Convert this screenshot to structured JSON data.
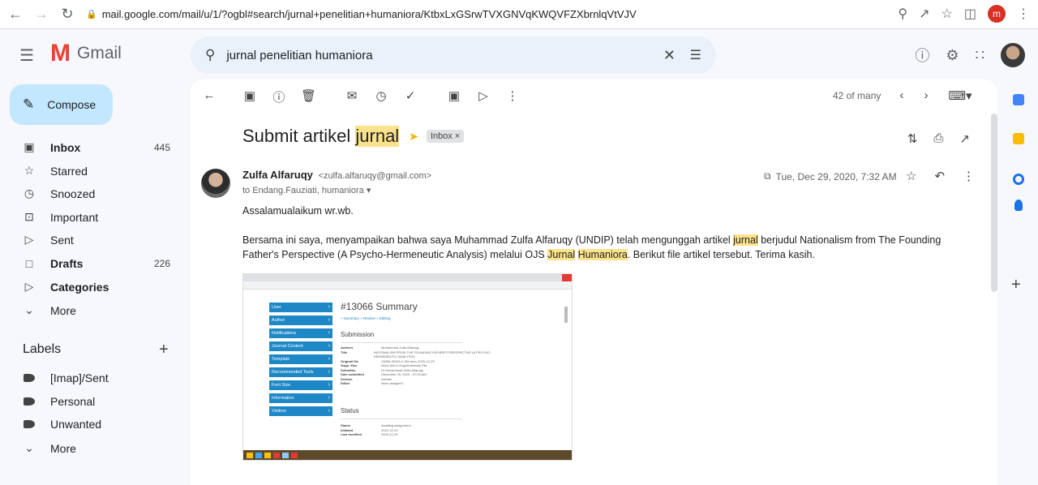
{
  "browser": {
    "url": "mail.google.com/mail/u/1/?ogbl#search/jurnal+penelitian+humaniora/KtbxLxGSrwTVXGNVqKWQVFZXbrnlqVtVJV",
    "profile_letter": "m"
  },
  "app": {
    "name": "Gmail"
  },
  "search": {
    "query": "jurnal penelitian humaniora"
  },
  "sidebar": {
    "compose": "Compose",
    "items": [
      {
        "label": "Inbox",
        "count": "445",
        "icon": "inbox-icon",
        "bold": true
      },
      {
        "label": "Starred",
        "count": "",
        "icon": "star-icon"
      },
      {
        "label": "Snoozed",
        "count": "",
        "icon": "clock-icon"
      },
      {
        "label": "Important",
        "count": "",
        "icon": "important-icon"
      },
      {
        "label": "Sent",
        "count": "",
        "icon": "send-icon"
      },
      {
        "label": "Drafts",
        "count": "226",
        "icon": "draft-icon",
        "bold": true
      },
      {
        "label": "Categories",
        "count": "",
        "icon": "label-icon",
        "bold": true
      },
      {
        "label": "More",
        "count": "",
        "icon": "chevron-down-icon"
      }
    ],
    "labels_title": "Labels",
    "labels": [
      {
        "label": "[Imap]/Sent"
      },
      {
        "label": "Personal"
      },
      {
        "label": "Unwanted"
      },
      {
        "label": "More"
      }
    ]
  },
  "toolbar": {
    "position": "42 of many"
  },
  "email": {
    "subject_prefix": "Submit artikel ",
    "subject_highlight": "jurnal",
    "label_chip": "Inbox",
    "sender_name": "Zulfa Alfaruqy",
    "sender_email": "<zulfa.alfaruqy@gmail.com>",
    "to_line": "to Endang.Fauziati, humaniora",
    "date": "Tue, Dec 29, 2020, 7:32 AM",
    "greeting": "Assalamualaikum wr.wb.",
    "body_part1": "Bersama ini saya, menyampaikan bahwa saya Muhammad Zulfa Alfaruqy (UNDIP) telah mengunggah artikel ",
    "body_hl1": "jurnal",
    "body_part2": " berjudul Nationalism from The Founding Father's Perspective (A Psycho-Hermeneutic Analysis) melalui OJS ",
    "body_hl2": "Jurnal",
    "body_hl3": "Humaniora",
    "body_part3": ". Berikut file artikel tersebut. Terima kasih."
  },
  "attachment_shot": {
    "title": "#13066 Summary",
    "links": "» Summary   » Review   » Editing",
    "submission": "Submission",
    "status": "Status",
    "menu": [
      "User",
      "Author",
      "Notifications",
      "Journal Content",
      "Template",
      "Recommended Tools",
      "Font Size",
      "Information",
      "Visitors"
    ],
    "rows": [
      {
        "k": "Authors",
        "v": "Muhammad Zulfa Alfaruqy"
      },
      {
        "k": "Title",
        "v": "NATIONALISM FROM THE FOUNDING FATHER'S PERSPECTIVE (A PSYCHO-HERMENEUTIC ANALYSIS)"
      },
      {
        "k": "Original file",
        "v": "13066-39106-1-SM.docx 2020-12-29"
      },
      {
        "k": "Supp. files",
        "v": "None   Add a Supplementary File"
      },
      {
        "k": "Submitter",
        "v": "Dr Muhammad Zulfa Alfaruqy"
      },
      {
        "k": "Date submitted",
        "v": "December 29, 2020 - 07:25 AM"
      },
      {
        "k": "Section",
        "v": "Articles"
      },
      {
        "k": "Editor",
        "v": "None assigned"
      }
    ],
    "status_rows": [
      {
        "k": "Status",
        "v": "Awaiting assignment"
      },
      {
        "k": "Initiated",
        "v": "2020-12-29"
      },
      {
        "k": "Last modified",
        "v": "2020-12-29"
      }
    ]
  }
}
